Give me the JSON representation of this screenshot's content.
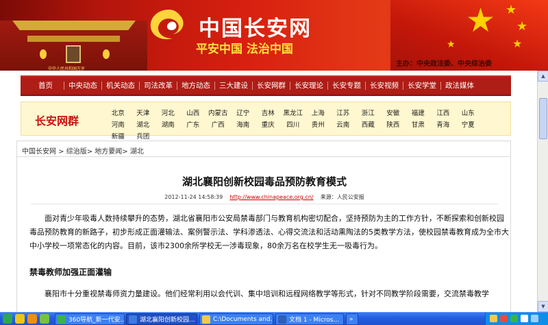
{
  "banner": {
    "site_title": "中国长安网",
    "slogan": "平安中国  法治中国",
    "sponsor": "主办：中央政法委、中央综治委",
    "gate_text": "中华人民共和国万岁"
  },
  "nav": {
    "home": "首页",
    "items": [
      "中央动态",
      "机关动态",
      "司法改革",
      "地方动态",
      "三大建设",
      "长安网群",
      "长安理论",
      "长安专题",
      "长安视频",
      "长安学堂",
      "政法媒体"
    ]
  },
  "provinces": {
    "title": "长安网群",
    "row1": [
      "北京",
      "天津",
      "河北",
      "山西",
      "内蒙古",
      "辽宁",
      "吉林",
      "黑龙江",
      "上海",
      "江苏",
      "浙江",
      "安徽",
      "福建",
      "江西",
      "山东",
      "河南"
    ],
    "row2": [
      "湖北",
      "湖南",
      "广东",
      "广西",
      "海南",
      "重庆",
      "四川",
      "贵州",
      "云南",
      "西藏",
      "陕西",
      "甘肃",
      "青海",
      "宁夏",
      "新疆",
      "兵团"
    ]
  },
  "breadcrumb": "中国长安网 > 综治版> 地方要闻> 湖北",
  "article": {
    "title": "湖北襄阳创新校园毒品预防教育模式",
    "date": "2012-11-24 14:58:39",
    "source_url": "http://www.chinapeace.org.cn/",
    "source": "来源：人民公安报",
    "paragraph1": "面对青少年吸毒人数持续攀升的态势，湖北省襄阳市公安局禁毒部门与教育机构密切配合，坚持预防为主的工作方针，不断探索和创新校园毒品预防教育的新路子，初步形成正面灌输法、案例警示法、学科渗透法、心得交流法和活动熏陶法的5类教学方法，使校园禁毒教育成为全市大中小学校一项常态化的内容。目前，该市2300余所学校无一涉毒现象，80余万名在校学生无一吸毒行为。",
    "subheading": "禁毒教师加强正面灌输",
    "paragraph2": "襄阳市十分重视禁毒师资力量建设。他们经常利用以会代训、集中培训和远程网络教学等形式，针对不同教学阶段需要，交流禁毒教学"
  },
  "taskbar": {
    "tasks": [
      {
        "label": "360导航_新一代安...",
        "icon_color": "#3bb34a"
      },
      {
        "label": "湖北襄阳创新校园...",
        "icon_color": "#3d7be0"
      },
      {
        "label": "C:\\Documents and...",
        "icon_color": "#f2c94c"
      },
      {
        "label": "文档 1 - Micros...",
        "icon_color": "#2f5fb8"
      }
    ],
    "overflow_label": "»",
    "colors": {
      "bar": "#245ee0",
      "tray": "#0f8ee8"
    }
  },
  "colors": {
    "banner_red": "#d8200f",
    "nav_red": "#ae1d16",
    "province_bg": "#fff7cf",
    "province_title": "#cc1111",
    "link_red": "#cc0000"
  }
}
